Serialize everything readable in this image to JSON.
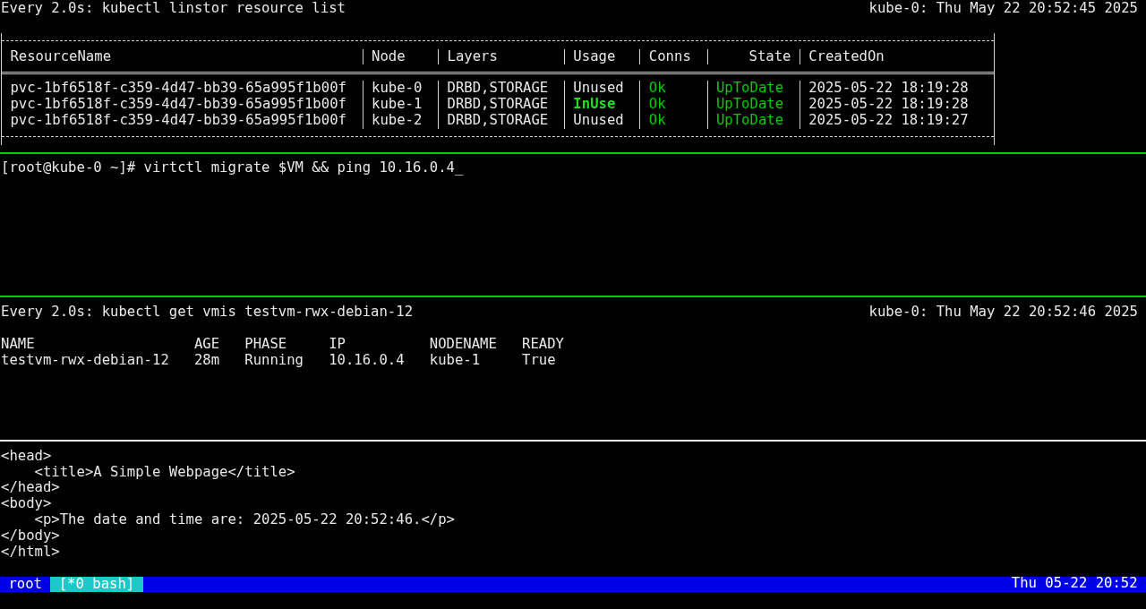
{
  "panes": [
    {
      "kind": "watch",
      "command": "Every 2.0s: kubectl linstor resource list",
      "host_time": "kube-0: Thu May 22 20:52:45 2025",
      "table": {
        "kind": "boxed",
        "columns": [
          "ResourceName",
          "Node",
          "Layers",
          "Usage",
          "Conns",
          "State",
          "CreatedOn"
        ],
        "rows": [
          {
            "cells": [
              {
                "text": "pvc-1bf6518f-c359-4d47-bb39-65a995f1b00f"
              },
              {
                "text": "kube-0"
              },
              {
                "text": "DRBD,STORAGE"
              },
              {
                "text": "Unused"
              },
              {
                "text": "Ok",
                "color": "#00cd00"
              },
              {
                "text": "UpToDate",
                "color": "#00cd00"
              },
              {
                "text": "2025-05-22 18:19:28"
              }
            ]
          },
          {
            "cells": [
              {
                "text": "pvc-1bf6518f-c359-4d47-bb39-65a995f1b00f"
              },
              {
                "text": "kube-1"
              },
              {
                "text": "DRBD,STORAGE"
              },
              {
                "text": "InUse",
                "color": "#22dd22",
                "bold": true
              },
              {
                "text": "Ok",
                "color": "#00cd00"
              },
              {
                "text": "UpToDate",
                "color": "#00cd00"
              },
              {
                "text": "2025-05-22 18:19:28"
              }
            ]
          },
          {
            "cells": [
              {
                "text": "pvc-1bf6518f-c359-4d47-bb39-65a995f1b00f"
              },
              {
                "text": "kube-2"
              },
              {
                "text": "DRBD,STORAGE"
              },
              {
                "text": "Unused"
              },
              {
                "text": "Ok",
                "color": "#00cd00"
              },
              {
                "text": "UpToDate",
                "color": "#00cd00"
              },
              {
                "text": "2025-05-22 18:19:27"
              }
            ]
          }
        ]
      }
    },
    {
      "kind": "shell",
      "prompt": "[root@kube-0 ~]#",
      "input": "virtctl migrate $VM && ping 10.16.0.4",
      "cursor": "_"
    },
    {
      "kind": "watch",
      "command": "Every 2.0s: kubectl get vmis testvm-rwx-debian-12",
      "host_time": "kube-0: Thu May 22 20:52:46 2025",
      "table": {
        "kind": "plain",
        "columns": [
          "NAME",
          "AGE",
          "PHASE",
          "IP",
          "NODENAME",
          "READY"
        ],
        "rows": [
          {
            "cells": [
              {
                "text": "testvm-rwx-debian-12"
              },
              {
                "text": "28m"
              },
              {
                "text": "Running"
              },
              {
                "text": "10.16.0.4"
              },
              {
                "text": "kube-1"
              },
              {
                "text": "True"
              }
            ]
          }
        ]
      }
    },
    {
      "kind": "output",
      "lines": [
        "<head>",
        "    <title>A Simple Webpage</title>",
        "</head>",
        "<body>",
        "    <p>The date and time are: 2025-05-22 20:52:46.</p>",
        "</body>",
        "</html>"
      ]
    }
  ],
  "pane_borders": [
    {
      "highlighted": true
    },
    {
      "highlighted": true
    },
    {
      "highlighted": false
    }
  ],
  "status_bar": {
    "session": "root",
    "windows": [
      {
        "label": "[*0 bash]",
        "selected": true
      }
    ],
    "clock": "Thu 05-22 20:52"
  }
}
